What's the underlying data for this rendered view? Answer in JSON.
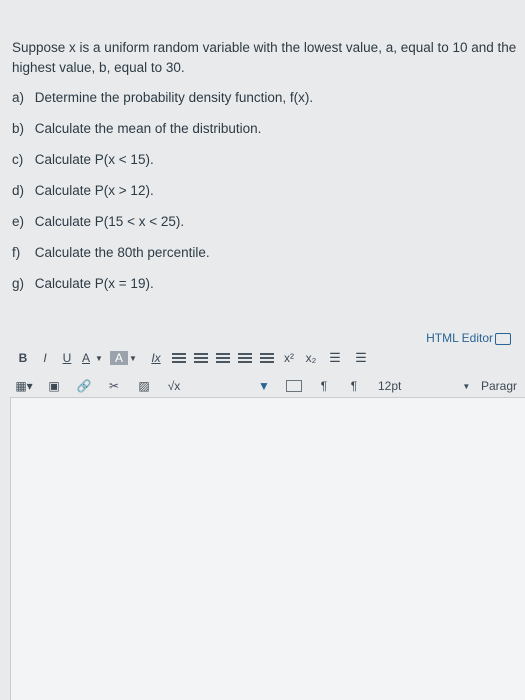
{
  "question": {
    "stem": "Suppose x is a uniform random variable with the lowest value, a, equal to 10 and the highest value, b, equal to 30.",
    "parts": [
      {
        "letter": "a)",
        "text": "Determine the probability density function, f(x)."
      },
      {
        "letter": "b)",
        "text": "Calculate the mean of the distribution."
      },
      {
        "letter": "c)",
        "text": "Calculate P(x < 15)."
      },
      {
        "letter": "d)",
        "text": "Calculate P(x > 12)."
      },
      {
        "letter": "e)",
        "text": "Calculate P(15 < x < 25)."
      },
      {
        "letter": "f)",
        "text": "Calculate the 80th percentile."
      },
      {
        "letter": "g)",
        "text": "Calculate P(x = 19)."
      }
    ]
  },
  "editor": {
    "html_editor_label": "HTML Editor",
    "toolbar": {
      "bold": "B",
      "italic": "I",
      "underline": "U",
      "font_color": "A",
      "background_color": "A",
      "clear_format": "Ix",
      "superscript": "x²",
      "subscript": "x₂",
      "font_size": "12pt",
      "paragraph": "Paragr",
      "ltr": "¶",
      "rtl": "¶",
      "math": "√x"
    }
  }
}
